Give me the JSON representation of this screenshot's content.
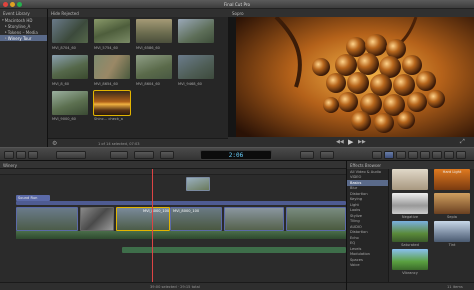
{
  "app": {
    "title": "Final Cut Pro"
  },
  "library": {
    "header": "Event Library",
    "items": [
      {
        "label": "Macintosh HD",
        "selected": false
      },
      {
        "label": "Storyline_A",
        "selected": false
      },
      {
        "label": "Tokens – Media",
        "selected": false
      },
      {
        "label": "Winery Tour",
        "selected": true
      }
    ]
  },
  "browser": {
    "header": "Hide Rejected",
    "clips": [
      {
        "label": ""
      },
      {
        "label": ""
      },
      {
        "label": ""
      },
      {
        "label": ""
      },
      {
        "label": "MVI_8704_60"
      },
      {
        "label": "MVI_5754_60"
      },
      {
        "label": "MVI_6586_60"
      },
      {
        "label": ""
      },
      {
        "label": "MVI_8_60"
      },
      {
        "label": "MVI_8654_60"
      },
      {
        "label": "MVI_8604_60"
      },
      {
        "label": "MVI_9468_60"
      },
      {
        "label": "MVI_9000_60"
      },
      {
        "label": "Shinc... check_a"
      }
    ],
    "status": "1 of 14 selected, 07:03"
  },
  "viewer": {
    "header": "Sopro"
  },
  "toolbar": {
    "timecode": "2:06"
  },
  "timeline": {
    "header": "Winery",
    "clip_labels": [
      "Sound Run",
      "MVI_8000_100",
      "MVI_8000_100"
    ],
    "status": "39:00 selected · 29:15 total"
  },
  "effects": {
    "header": "Effects Browser",
    "categories": [
      {
        "label": "All Video & Audio",
        "selected": false
      },
      {
        "label": "VIDEO",
        "selected": false
      },
      {
        "label": "Basics",
        "selected": true
      },
      {
        "label": "Blur",
        "selected": false
      },
      {
        "label": "Distortion",
        "selected": false
      },
      {
        "label": "Keying",
        "selected": false
      },
      {
        "label": "Light",
        "selected": false
      },
      {
        "label": "Looks",
        "selected": false
      },
      {
        "label": "Stylize",
        "selected": false
      },
      {
        "label": "Tiling",
        "selected": false
      },
      {
        "label": "AUDIO",
        "selected": false
      },
      {
        "label": "Distortion",
        "selected": false
      },
      {
        "label": "Echo",
        "selected": false
      },
      {
        "label": "EQ",
        "selected": false
      },
      {
        "label": "Levels",
        "selected": false
      },
      {
        "label": "Modulation",
        "selected": false
      },
      {
        "label": "Spaces",
        "selected": false
      },
      {
        "label": "Voice",
        "selected": false
      }
    ],
    "thumbs": [
      {
        "label": ""
      },
      {
        "label": "Hard Light"
      },
      {
        "label": "Negative"
      },
      {
        "label": "Sepia"
      },
      {
        "label": "Saturated"
      },
      {
        "label": "Tint"
      },
      {
        "label": "Vibrancy"
      },
      {
        "label": ""
      }
    ],
    "count": "11 items"
  }
}
